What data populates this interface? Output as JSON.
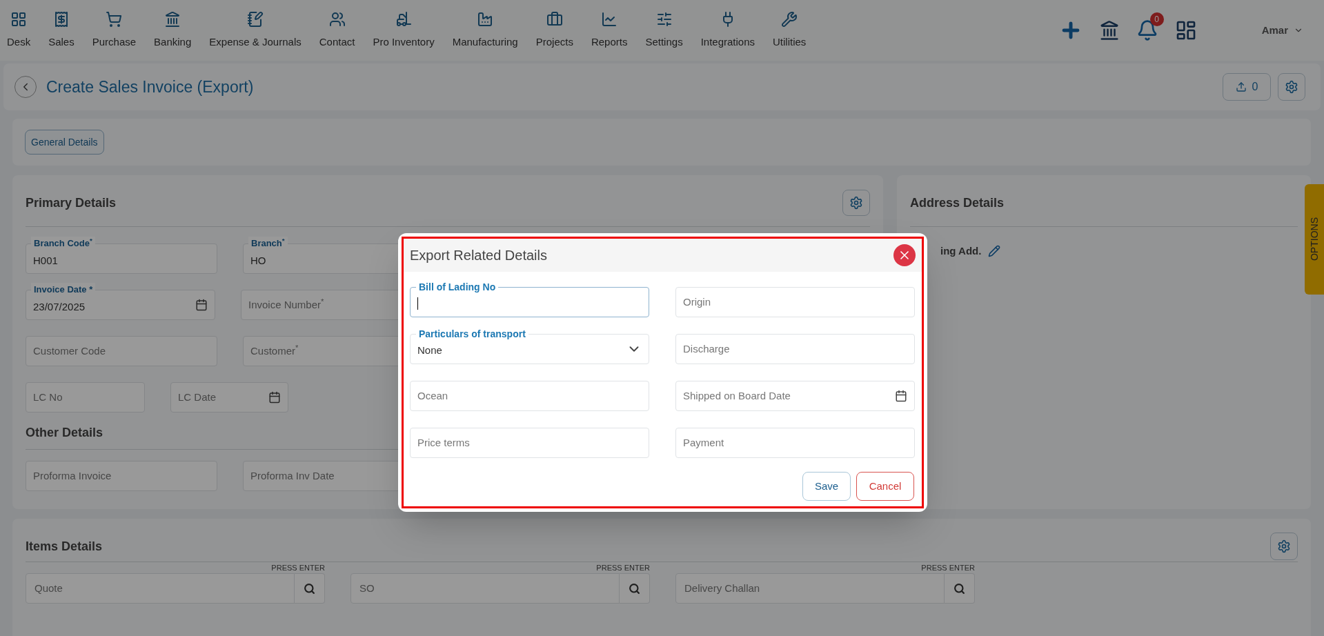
{
  "nav": {
    "items": [
      {
        "label": "Desk"
      },
      {
        "label": "Sales"
      },
      {
        "label": "Purchase"
      },
      {
        "label": "Banking"
      },
      {
        "label": "Expense & Journals"
      },
      {
        "label": "Contact"
      },
      {
        "label": "Pro Inventory"
      },
      {
        "label": "Manufacturing"
      },
      {
        "label": "Projects"
      },
      {
        "label": "Reports"
      },
      {
        "label": "Settings"
      },
      {
        "label": "Integrations"
      },
      {
        "label": "Utilities"
      }
    ],
    "notification_count": "0",
    "user": "Amar"
  },
  "page_header": {
    "title": "Create Sales Invoice (Export)",
    "upload_count": "0"
  },
  "tabs": [
    {
      "label": "General Details",
      "selected": true
    }
  ],
  "primary_details": {
    "title": "Primary Details",
    "rows": [
      [
        {
          "kind": "text",
          "label": "Branch Code$^{*}$",
          "value": "H001"
        },
        {
          "kind": "text",
          "label": "Branch$^{*}$",
          "value": "HO"
        }
      ],
      [
        {
          "kind": "date",
          "label": "Invoice Date *",
          "value": "23/07/2025"
        },
        {
          "kind": "text",
          "placeholder": "Invoice Number$^{*}$"
        }
      ],
      [
        {
          "kind": "text",
          "placeholder": "Customer Code"
        },
        {
          "kind": "text",
          "placeholder": "Customer$^{*}$"
        }
      ],
      [
        {
          "kind": "short",
          "placeholder": "LC No"
        },
        {
          "kind": "shortdate",
          "placeholder": "LC Date"
        }
      ]
    ]
  },
  "other_details": {
    "title": "Other Details",
    "rows": [
      [
        {
          "kind": "text",
          "placeholder": "Proforma Invoice"
        },
        {
          "kind": "text",
          "placeholder": "Proforma Inv Date"
        }
      ]
    ]
  },
  "address_details": {
    "title": "Address Details",
    "label": "ing Add."
  },
  "options_tab": "OPTIONS",
  "items_details": {
    "title": "Items Details",
    "searches": [
      {
        "hint": "PRESS ENTER",
        "placeholder": "Quote"
      },
      {
        "hint": "PRESS ENTER",
        "placeholder": "SO"
      },
      {
        "hint": "PRESS ENTER",
        "placeholder": "Delivery Challan"
      }
    ]
  },
  "dialog": {
    "title": "Export Related Details",
    "fields": [
      {
        "kind": "text",
        "label": "Bill of Lading No",
        "focused": true
      },
      {
        "kind": "text",
        "placeholder": "Origin"
      },
      {
        "kind": "select",
        "label": "Particulars of transport",
        "value": "None"
      },
      {
        "kind": "text",
        "placeholder": "Discharge"
      },
      {
        "kind": "text",
        "placeholder": "Ocean"
      },
      {
        "kind": "date",
        "placeholder": "Shipped on Board Date"
      },
      {
        "kind": "text",
        "placeholder": "Price terms"
      },
      {
        "kind": "text",
        "placeholder": "Payment"
      }
    ],
    "buttons": [
      {
        "kind": "save",
        "label": "Save"
      },
      {
        "kind": "cancel",
        "label": "Cancel"
      }
    ]
  }
}
